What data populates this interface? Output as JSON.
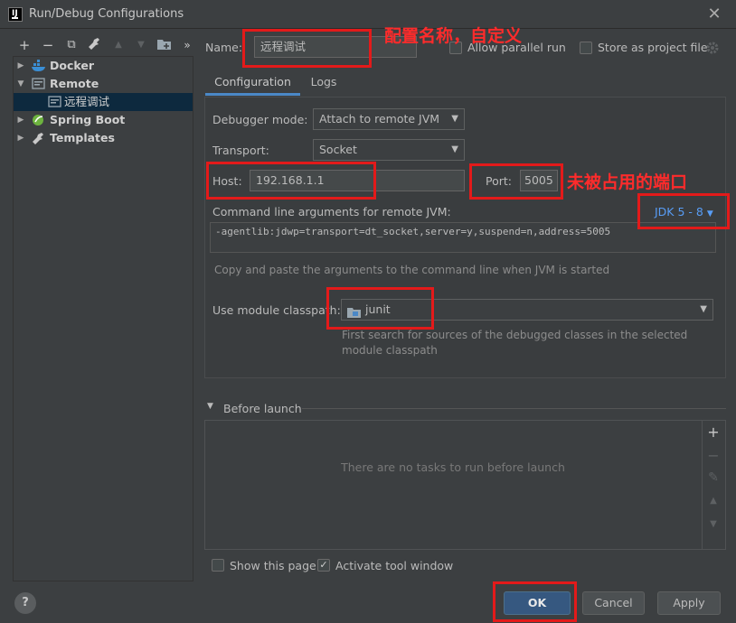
{
  "window": {
    "title": "Run/Debug Configurations",
    "close_glyph": "✕",
    "logo_text": "IJ"
  },
  "toolbar": {
    "add": "+",
    "remove": "−",
    "copy": "⧉",
    "edit": "🔧",
    "move_up": "▲",
    "move_down": "▼",
    "folder": "📁",
    "more": "»"
  },
  "tree": {
    "items": [
      {
        "label": "Docker",
        "icon": "docker-icon",
        "expanded": false
      },
      {
        "label": "Remote",
        "icon": "remote-icon",
        "expanded": true
      },
      {
        "label": "远程调试",
        "icon": "remote-config-icon",
        "selected": true
      },
      {
        "label": "Spring Boot",
        "icon": "spring-boot-icon",
        "expanded": false
      },
      {
        "label": "Templates",
        "icon": "wrench-icon",
        "expanded": false
      }
    ]
  },
  "name_row": {
    "label": "Name:",
    "value": "远程调试",
    "allow_parallel_label": "Allow parallel run",
    "store_label": "Store as project file"
  },
  "tabs": [
    {
      "label": "Configuration",
      "active": true
    },
    {
      "label": "Logs",
      "active": false
    }
  ],
  "config": {
    "debugger_mode_label": "Debugger mode:",
    "debugger_mode_value": "Attach to remote JVM",
    "transport_label": "Transport:",
    "transport_value": "Socket",
    "host_label": "Host:",
    "host_value": "192.168.1.1",
    "port_label": "Port:",
    "port_value": "5005",
    "cmdline_label": "Command line arguments for remote JVM:",
    "jdk_link": "JDK 5 - 8",
    "cmdline_value": "-agentlib:jdwp=transport=dt_socket,server=y,suspend=n,address=5005",
    "cmdline_hint": "Copy and paste the arguments to the command line when JVM is started",
    "module_label": "Use module classpath:",
    "module_value": "junit",
    "module_hint_1": "First search for sources of the debugged classes in the selected",
    "module_hint_2": "module classpath"
  },
  "before_launch": {
    "label": "Before launch",
    "empty_text": "There are no tasks to run before launch",
    "add": "+",
    "remove": "−",
    "edit": "✎",
    "up": "▲",
    "down": "▼"
  },
  "footer": {
    "show_page_label": "Show this page",
    "activate_tool_label": "Activate tool window",
    "ok": "OK",
    "cancel": "Cancel",
    "apply": "Apply",
    "help": "?"
  },
  "annotations": {
    "name_note": "配置名称，自定义",
    "port_note": "未被占用的端口"
  },
  "colors": {
    "background": "#3c3f41",
    "selection": "#0d293e",
    "accent": "#4a88c7",
    "link": "#589df6",
    "annotation_red": "#e31a1a"
  }
}
